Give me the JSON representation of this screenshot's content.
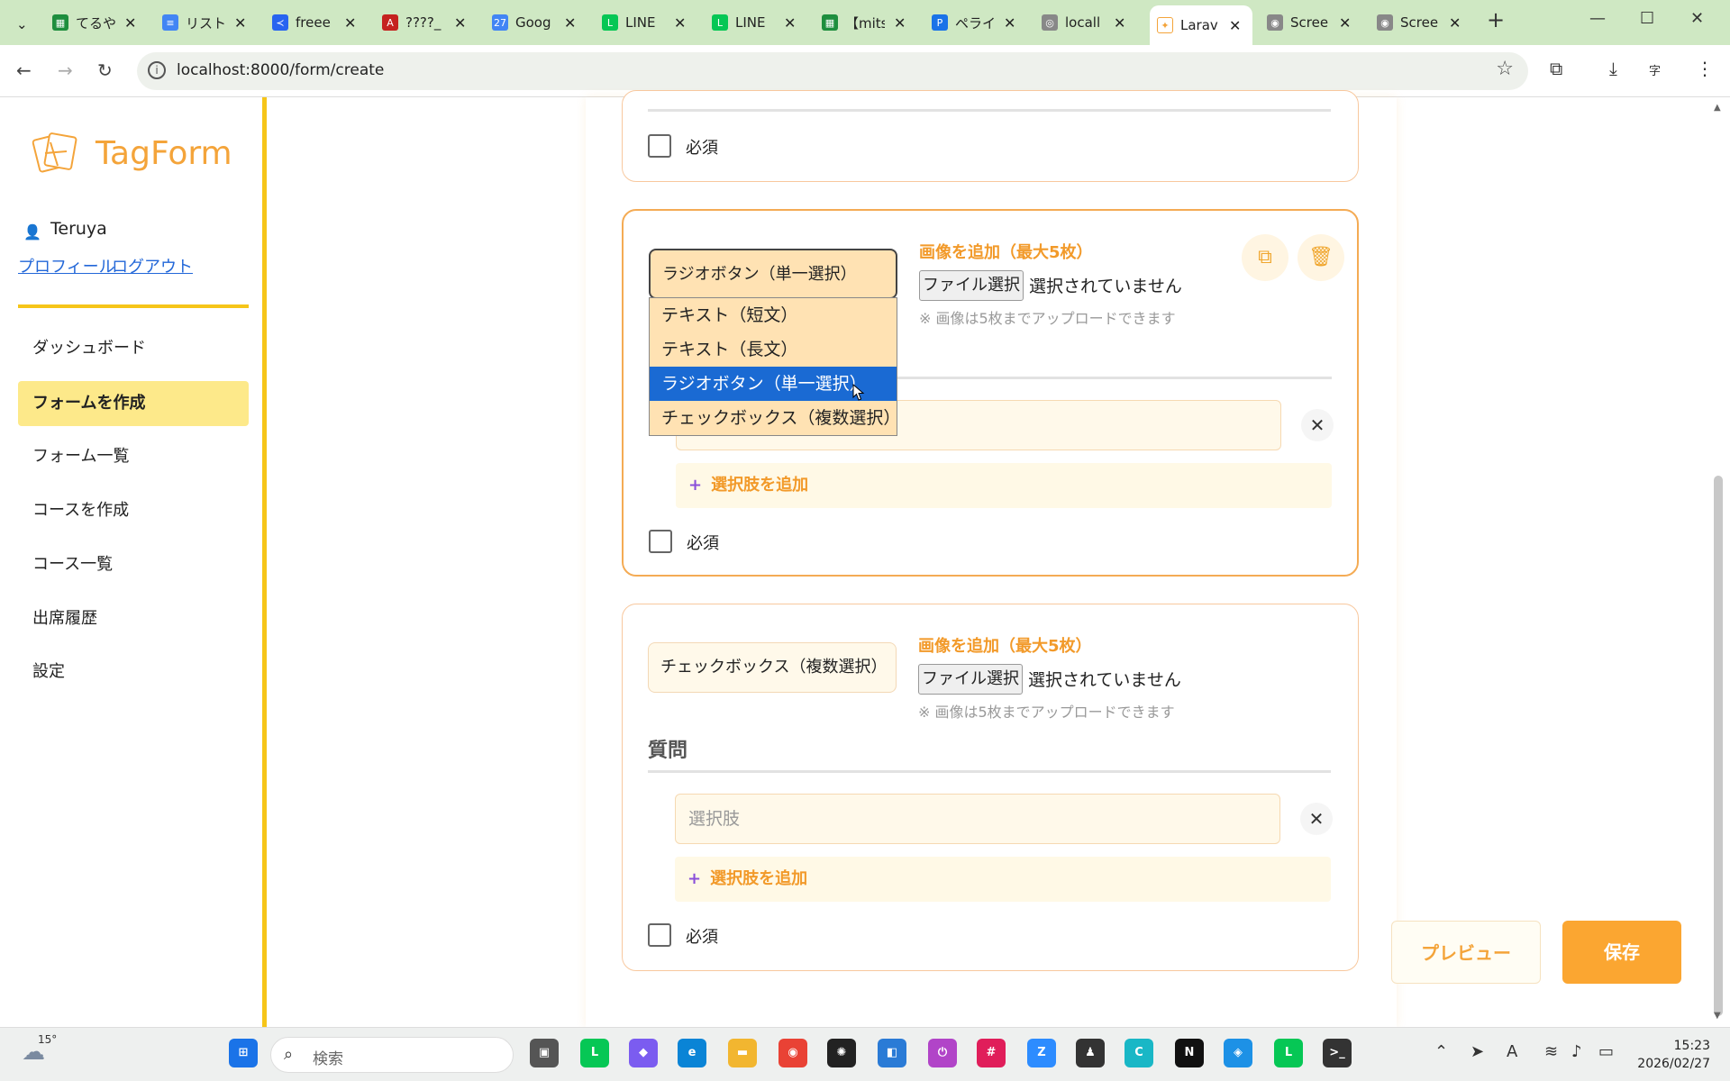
{
  "browser": {
    "tabs": [
      {
        "title": "てるや",
        "icon": "sheets-icon",
        "color": "#1e8e3e"
      },
      {
        "title": "リスト",
        "icon": "docs-icon",
        "color": "#4285f4"
      },
      {
        "title": "freee",
        "icon": "freee-icon",
        "color": "#2864f0"
      },
      {
        "title": "????_",
        "icon": "pdf-icon",
        "color": "#c5221f"
      },
      {
        "title": "Goog",
        "icon": "calendar-icon",
        "color": "#4285f4"
      },
      {
        "title": "LINE",
        "icon": "line-icon",
        "color": "#06c755"
      },
      {
        "title": "LINE",
        "icon": "line-icon",
        "color": "#06c755"
      },
      {
        "title": "【mits",
        "icon": "sheets-icon",
        "color": "#1e8e3e"
      },
      {
        "title": "ペライ",
        "icon": "perai-icon",
        "color": "#1a73e8"
      },
      {
        "title": "locall",
        "icon": "globe-icon",
        "color": "#888888"
      },
      {
        "title": "Larav",
        "icon": "tagform-icon",
        "color": "#f4a43a"
      },
      {
        "title": "Scree",
        "icon": "camera-icon",
        "color": "#888888"
      },
      {
        "title": "Scree",
        "icon": "camera-icon",
        "color": "#888888"
      }
    ],
    "url": "localhost:8000/form/create"
  },
  "sidebar": {
    "logo": "TagForm",
    "user_name": "Teruya",
    "profile_link": "プロフィール",
    "logout_link": "ログアウト",
    "menu": [
      {
        "label": "ダッシュボード"
      },
      {
        "label": "フォームを作成"
      },
      {
        "label": "フォーム一覧"
      },
      {
        "label": "コースを作成"
      },
      {
        "label": "コース一覧"
      },
      {
        "label": "出席履歴"
      },
      {
        "label": "設定"
      }
    ]
  },
  "form": {
    "top_card": {
      "required_label": "必須"
    },
    "radio_card": {
      "type_value": "ラジオボタン（単一選択）",
      "image_title": "画像を追加（最大5枚）",
      "file_button": "ファイル選択",
      "file_status": "選択されていません",
      "image_note": "※ 画像は5枚までアップロードできます",
      "add_option": "選択肢を追加",
      "required_label": "必須"
    },
    "checkbox_card": {
      "type_value": "チェックボックス（複数選択）",
      "image_title": "画像を追加（最大5枚）",
      "file_button": "ファイル選択",
      "file_status": "選択されていません",
      "image_note": "※ 画像は5枚までアップロードできます",
      "question_label": "質問",
      "option_placeholder": "選択肢",
      "add_option": "選択肢を追加",
      "required_label": "必須"
    },
    "type_options": [
      "テキスト（短文）",
      "テキスト（長文）",
      "ラジオボタン（単一選択）",
      "チェックボックス（複数選択）"
    ],
    "highlighted_option_index": 2
  },
  "actions": {
    "preview": "プレビュー",
    "save": "保存"
  },
  "taskbar": {
    "weather_temp": "15°",
    "search_placeholder": "検索",
    "time": "15:23",
    "date": "2026/02/27"
  },
  "colors": {
    "accent": "#f4a43a",
    "sidebar_border": "#f6c519",
    "highlight": "#1a6ad3",
    "save": "#fba631"
  }
}
